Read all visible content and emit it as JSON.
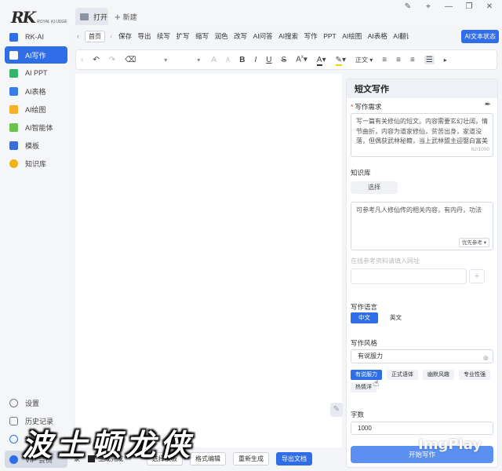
{
  "app": {
    "logo_text": "RK",
    "logo_sub": "ROYAL KLUDGE"
  },
  "sidebar": {
    "items": [
      {
        "label": "RK-AI",
        "color": "#2f6ee6"
      },
      {
        "label": "AI写作",
        "color": "#ffffff",
        "active": true
      },
      {
        "label": "AI PPT",
        "color": "#34b36a"
      },
      {
        "label": "AI表格",
        "color": "#3a7bea"
      },
      {
        "label": "AI绘图",
        "color": "#f5b023"
      },
      {
        "label": "AI智能体",
        "color": "#6cc24a"
      },
      {
        "label": "模板",
        "color": "#3a6fd8"
      },
      {
        "label": "知识库",
        "color": "#f0b21a"
      }
    ],
    "bottom": {
      "settings": "设置",
      "history": "历史记录",
      "mine": "我的",
      "vip": "VIP 会员"
    }
  },
  "tabs": {
    "open": "打开",
    "new": "新建"
  },
  "menu": {
    "home": "首页",
    "items": [
      "保存",
      "导出",
      "续写",
      "扩写",
      "缩写",
      "润色",
      "改写",
      "AI问答",
      "AI搜索",
      "写作",
      "PPT",
      "AI绘图",
      "AI表格",
      "AI翻译"
    ],
    "ai_toggle": "AI文本状态"
  },
  "toolbar": {
    "undo": "↶",
    "redo": "↷",
    "eraser": "⌫",
    "bold": "B",
    "italic": "I",
    "underline": "U",
    "strike": "S",
    "font_size_up": "A",
    "font_size_down": "A",
    "font_color": "A",
    "highlight": "✎",
    "paragraph": "正文"
  },
  "panel": {
    "title": "短文写作",
    "req_label": "写作需求",
    "req_text": "写一篇有关修仙的短文。内容需要玄幻壮阔，情节曲折，内容为道家修仙，贫苦出身，家道没落，但偶获武林秘籍，当上武林盟主迎娶白富美",
    "req_counter": "62/1000",
    "kb_label": "知识库",
    "kb_choose": "选择",
    "kb_text": "可参考凡人修仙传的相关内容，有内丹，功法",
    "kb_priority": "优先参考",
    "url_placeholder": "在线参考资料请填入网址",
    "lang_label": "写作语言",
    "lang_options": [
      "中文",
      "英文"
    ],
    "lang_selected": "中文",
    "style_label": "写作风格",
    "style_value": "有说服力",
    "style_tags": [
      "有说服力",
      "正式语体",
      "幽默风趣",
      "专业性强",
      "热情洋"
    ],
    "style_tag_selected": "有说服力",
    "count_label": "字数",
    "count_value": "1000",
    "start_button": "开始写作"
  },
  "bottombar": {
    "left_text": "录",
    "status": "生成完成",
    "buttons": [
      "选择模板",
      "格式编辑",
      "重新生成",
      "导出文档"
    ]
  },
  "overlay": {
    "caption": "波士顿龙侠",
    "watermark": "ImgPlay"
  }
}
